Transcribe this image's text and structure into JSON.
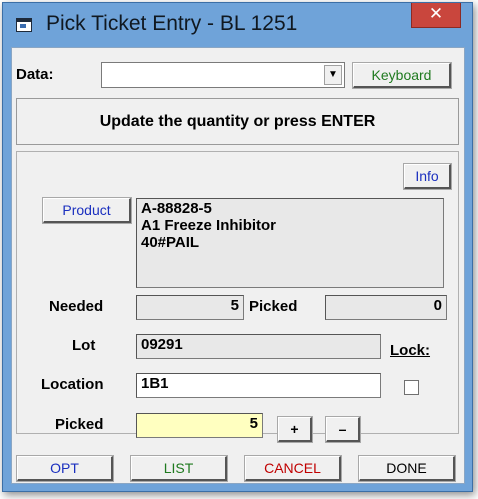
{
  "window": {
    "title": "Pick Ticket Entry - BL 1251",
    "close_glyph": "✕"
  },
  "data_row": {
    "label": "Data:",
    "value": "",
    "dropdown_glyph": "▼",
    "keyboard_label": "Keyboard"
  },
  "message": "Update the quantity or press ENTER",
  "info_label": "Info",
  "product": {
    "button_label": "Product",
    "lines": [
      "A-88828-5",
      "A1 Freeze Inhibitor",
      "40#PAIL"
    ]
  },
  "needed": {
    "label": "Needed",
    "value": "5"
  },
  "picked_total": {
    "label": "Picked",
    "value": "0"
  },
  "lot": {
    "label": "Lot",
    "value": "09291"
  },
  "lock": {
    "label": "Lock:",
    "checked": false
  },
  "location": {
    "label": "Location",
    "value": "1B1"
  },
  "picked_qty": {
    "label": "Picked",
    "value": "5",
    "plus_label": "+",
    "minus_label": "–"
  },
  "buttons": {
    "opt": "OPT",
    "list": "LIST",
    "cancel": "CANCEL",
    "done": "DONE"
  },
  "colors": {
    "titlebar": "#6fa3d9",
    "close": "#c9463d",
    "accent_text": "#1a2fbf",
    "keyboard_text": "#1f7a1f",
    "cancel_text": "#c00000",
    "picked_bg": "#ffffc0"
  }
}
